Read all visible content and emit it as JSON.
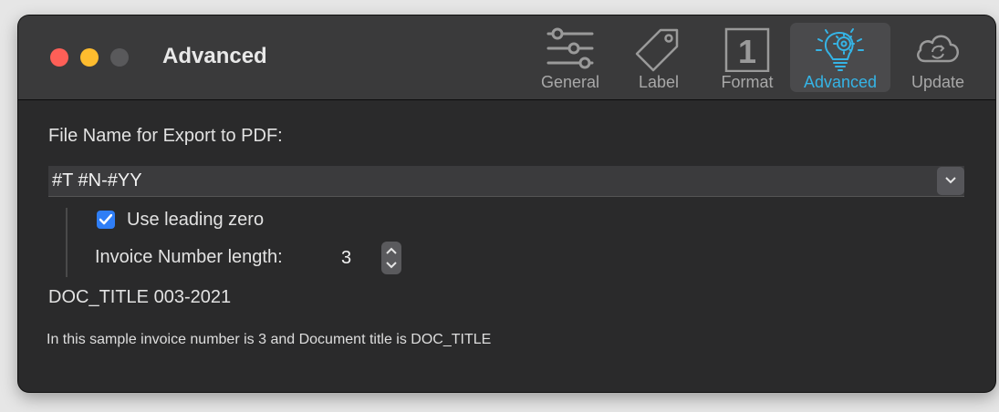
{
  "window": {
    "title": "Advanced"
  },
  "toolbar": {
    "items": [
      {
        "label": "General",
        "icon": "sliders-icon",
        "active": false
      },
      {
        "label": "Label",
        "icon": "tag-icon",
        "active": false
      },
      {
        "label": "Format",
        "icon": "number-one-icon",
        "active": false
      },
      {
        "label": "Advanced",
        "icon": "lightbulb-gear-icon",
        "active": true
      },
      {
        "label": "Update",
        "icon": "cloud-sync-icon",
        "active": false
      }
    ],
    "format_glyph": "1"
  },
  "export": {
    "label": "File Name for Export to PDF:",
    "value": "#T #N-#YY"
  },
  "leading_zero": {
    "label": "Use leading zero",
    "checked": true
  },
  "number_length": {
    "label": "Invoice Number length:",
    "value": "3"
  },
  "preview": "DOC_TITLE 003-2021",
  "note": "In this sample invoice number is 3 and Document title is DOC_TITLE",
  "colors": {
    "accent": "#35b4e6",
    "checkbox": "#2f7ef6"
  }
}
